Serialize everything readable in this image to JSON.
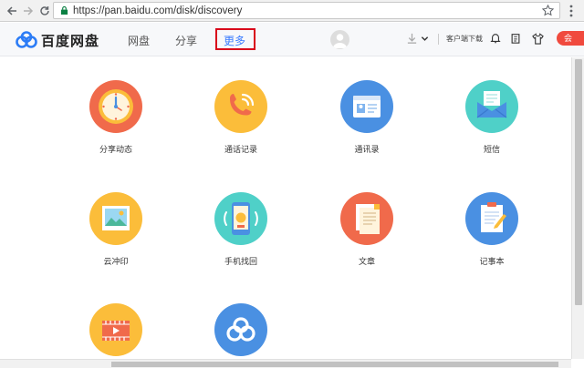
{
  "browser": {
    "url": "https://pan.baidu.com/disk/discovery"
  },
  "header": {
    "logo_text": "百度网盘",
    "nav": [
      {
        "label": "网盘",
        "active": false
      },
      {
        "label": "分享",
        "active": false
      },
      {
        "label": "更多",
        "active": true
      }
    ],
    "client_download": "客户端下载",
    "vip_label": "会"
  },
  "tiles": [
    {
      "label": "分享动态",
      "icon": "clock-icon",
      "color": "#f06a4b"
    },
    {
      "label": "通话记录",
      "icon": "phone-icon",
      "color": "#fbbd3a"
    },
    {
      "label": "通讯录",
      "icon": "contact-card-icon",
      "color": "#4a90e2"
    },
    {
      "label": "短信",
      "icon": "envelope-icon",
      "color": "#4fd0c8"
    },
    {
      "label": "云冲印",
      "icon": "photo-icon",
      "color": "#fbbd3a"
    },
    {
      "label": "手机找回",
      "icon": "phone-locate-icon",
      "color": "#4fd0c8"
    },
    {
      "label": "文章",
      "icon": "article-icon",
      "color": "#f06a4b"
    },
    {
      "label": "记事本",
      "icon": "notepad-icon",
      "color": "#4a90e2"
    },
    {
      "label": "",
      "icon": "video-icon",
      "color": "#fbbd3a"
    },
    {
      "label": "",
      "icon": "baidu-cloud-icon",
      "color": "#4a90e2"
    }
  ],
  "colors": {
    "accent": "#3a7bfe",
    "highlight_box": "#d9061a"
  }
}
